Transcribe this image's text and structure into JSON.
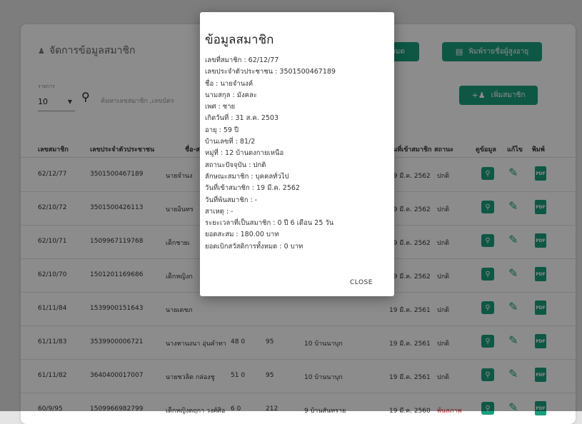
{
  "page": {
    "title": "จัดการข้อมูลสมาชิก",
    "delete_all_label": "หมด",
    "print_elderly_label": "พิมพ์รายชื่อผู้สูงอายุ",
    "add_member_label": "เพิ่มสมาชิก",
    "per_page_label": "รายการ",
    "per_page_value": "10",
    "search_placeholder": "ค้นหาเลขสมาชิก ,เลขบัตร"
  },
  "table": {
    "headers": [
      "เลขสมาชิก",
      "เลขประจำตัวประชาชน",
      "ชื่อ-ส",
      "",
      "",
      "",
      "วันที่เข้าสมาชิก",
      "สถานะ",
      "ดูข้อมูล",
      "แก้ไข",
      "พิมพ์"
    ],
    "rows": [
      {
        "id": "62/12/77",
        "cid": "3501500467189",
        "name": "นายจำนง",
        "age": "",
        "n": "",
        "village": "",
        "joined": "19 มี.ค. 2562",
        "status": "ปกติ"
      },
      {
        "id": "62/10/72",
        "cid": "3501500426113",
        "name": "นายอินทร",
        "age": "",
        "n": "",
        "village": "",
        "joined": "19 มี.ค. 2562",
        "status": "ปกติ"
      },
      {
        "id": "62/10/71",
        "cid": "1509967119768",
        "name": "เด็กชายเ",
        "age": "",
        "n": "",
        "village": "",
        "joined": "19 มี.ค. 2562",
        "status": "ปกติ"
      },
      {
        "id": "62/10/70",
        "cid": "1501201169686",
        "name": "เด็กหญิงก",
        "age": "",
        "n": "",
        "village": "",
        "joined": "19 มี.ค. 2562",
        "status": "ปกติ"
      },
      {
        "id": "61/11/84",
        "cid": "1539900151643",
        "name": "นายเตชภ",
        "age": "",
        "n": "",
        "village": "",
        "joined": "19 มี.ค. 2561",
        "status": "ปกติ"
      },
      {
        "id": "61/11/83",
        "cid": "3539900006721",
        "name": "นางทานงนา อุ่นคำทา",
        "age": "48 0",
        "n": "95",
        "village": "10 บ้านนาบุก",
        "joined": "19 มี.ค. 2561",
        "status": "ปกติ"
      },
      {
        "id": "61/11/82",
        "cid": "3640400017007",
        "name": "นายชวลิต กล่องชู",
        "age": "51 0",
        "n": "95",
        "village": "10 บ้านนาบุก",
        "joined": "19 มี.ค. 2561",
        "status": "ปกติ"
      },
      {
        "id": "60/9/95",
        "cid": "1509966982799",
        "name": "เด็กหญิงตฤกา วงศ์ศิอ",
        "age": "6 0",
        "n": "212",
        "village": "9 บ้านสันทราย",
        "joined": "19 มี.ค. 2560",
        "status": "พ้นสภาพ"
      }
    ],
    "pdf_label": "PDF"
  },
  "modal": {
    "title": "ข้อมูลสมาชิก",
    "lines": [
      "เลขที่สมาชิก : 62/12/77",
      "เลขประจำตัวประชาชน : 3501500467189",
      "ชื่อ : นายจำนงค์",
      "นามสกุล : มังคละ",
      "เพศ : ชาย",
      "เกิดวันที่ : 31 ส.ค. 2503",
      "อายุ : 59 ปี",
      "บ้านเลขที่ : 81/2",
      "หมู่ที่ : 12 บ้านดงกายเหนือ",
      "สถานะปัจจุบัน : ปกติ",
      "ลักษณะสมาชิก : บุคคลทั่วไป",
      "วันที่เข้าสมาชิก : 19 มี.ค. 2562",
      "วันที่พ้นสมาชิก : -",
      "สาเหตุ : -",
      "ระยะเวลาที่เป็นสมาชิก : 0 ปี 6 เดือน 25 วัน",
      "ยอดสะสม : 180.00 บาท",
      "ยอดเบิกสวัสดิการทั้งหมด : 0 บาท"
    ],
    "close_label": "CLOSE"
  },
  "colors": {
    "accent": "#1a9f7d",
    "danger": "#d32f2f"
  },
  "icons": {
    "title": "users-icon",
    "search": "search-icon",
    "add": "add-user-icon",
    "print": "print-icon",
    "view": "view-icon",
    "edit": "pencil-icon",
    "pdf": "pdf-icon"
  }
}
